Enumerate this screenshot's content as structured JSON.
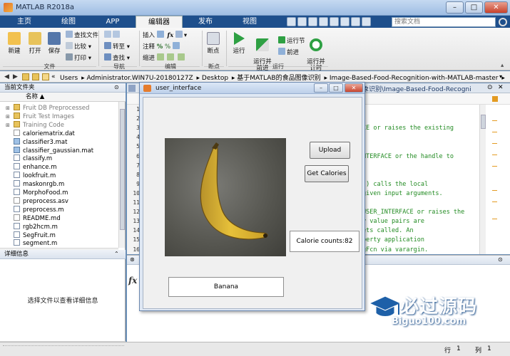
{
  "window": {
    "title": "MATLAB R2018a"
  },
  "tabs": [
    "主页",
    "绘图",
    "APP",
    "编辑器",
    "发布",
    "视图"
  ],
  "search_placeholder": "搜索文档",
  "ribbon": {
    "file_group": {
      "label": "文件",
      "buttons": [
        "新建",
        "打开",
        "保存"
      ],
      "small": [
        "查找文件",
        "比较",
        "打印"
      ]
    },
    "nav_group": {
      "label": "导航",
      "small": [
        "转至",
        "查找"
      ]
    },
    "edit_group": {
      "label": "编辑",
      "small": [
        "插入",
        "注释",
        "缩进"
      ],
      "fx": "fx"
    },
    "breakpoint_group": {
      "label": "断点",
      "button": "断点"
    },
    "run_group": {
      "label": "运行",
      "buttons": [
        "运行",
        "运行并\n前进",
        "运行并\n计时"
      ],
      "small": [
        "运行节",
        "前进"
      ]
    }
  },
  "path": [
    "Users",
    "Administrator.WIN7U-20180127Z",
    "Desktop",
    "基于MATLAB的食品图像识别",
    "Image-Based-Food-Recognition-with-MATLAB-master"
  ],
  "current_folder": {
    "title": "当前文件夹",
    "column": "名称 ▲",
    "items": [
      {
        "name": "Fruit DB Preprocessed",
        "type": "folder",
        "greyed": true
      },
      {
        "name": "Fruit Test Images",
        "type": "folder",
        "greyed": true
      },
      {
        "name": "Training Code",
        "type": "folder",
        "greyed": true
      },
      {
        "name": "caloriematrix.dat",
        "type": "txt"
      },
      {
        "name": "classifier3.mat",
        "type": "mat"
      },
      {
        "name": "classifier_gaussian.mat",
        "type": "mat"
      },
      {
        "name": "classify.m",
        "type": "m"
      },
      {
        "name": "enhance.m",
        "type": "m"
      },
      {
        "name": "lookfruit.m",
        "type": "m"
      },
      {
        "name": "maskonrgb.m",
        "type": "m"
      },
      {
        "name": "MorphoFood.m",
        "type": "m"
      },
      {
        "name": "preprocess.asv",
        "type": "txt"
      },
      {
        "name": "preprocess.m",
        "type": "m"
      },
      {
        "name": "README.md",
        "type": "txt"
      },
      {
        "name": "rgb2hcm.m",
        "type": "m"
      },
      {
        "name": "SegFruit.m",
        "type": "m"
      },
      {
        "name": "segment.m",
        "type": "m"
      }
    ]
  },
  "details": {
    "title": "详细信息",
    "message": "选择文件以查看详细信息"
  },
  "editor": {
    "path_fragment": "象识别\\Image-Based-Food-Recogni",
    "line_numbers": [
      "1",
      "2",
      "3",
      "4",
      "5",
      "6",
      "7",
      "8",
      "9",
      "10",
      "11",
      "12",
      "13",
      "14",
      "15",
      "16"
    ],
    "code_lines": [
      {
        "line": 3,
        "text": "CE or raises the existing"
      },
      {
        "line": 6,
        "text": "NTERFACE or the handle to"
      },
      {
        "line": 9,
        "text": ".) calls the local"
      },
      {
        "line": 10,
        "text": "given input arguments."
      },
      {
        "line": 12,
        "text": "USER_INTERFACE or raises the"
      },
      {
        "line": 13,
        "text": "y value pairs are"
      },
      {
        "line": 14,
        "text": "ets called.  An"
      },
      {
        "line": 15,
        "text": "perty application"
      },
      {
        "line": 16,
        "text": "gFcn via varargin."
      }
    ]
  },
  "status": {
    "row_label": "行",
    "row": "1",
    "col_label": "列",
    "col": "1"
  },
  "figure": {
    "title": "user_interface",
    "upload_label": "Upload",
    "get_calories_label": "Get Calories",
    "calorie_text": "Calorie counts:82",
    "result_text": "Banana"
  },
  "watermark": {
    "cn": "必过源码",
    "url": "Biguo100.com"
  },
  "colors": {
    "ribbon_blue": "#1e4f8c",
    "code_green": "#228b22",
    "marker_orange": "#e39b22"
  }
}
